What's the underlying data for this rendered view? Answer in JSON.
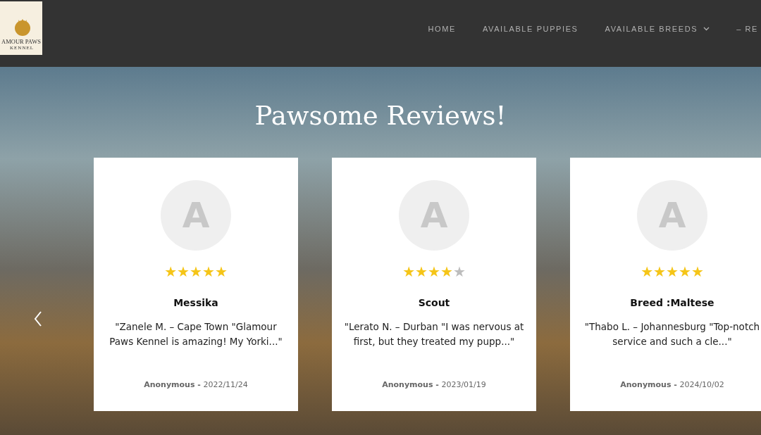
{
  "logo": {
    "name": "AMOUR PAWS",
    "tagline": "KENNEL"
  },
  "nav": [
    {
      "label": "HOME",
      "dropdown": false
    },
    {
      "label": "AVAILABLE PUPPIES",
      "dropdown": false
    },
    {
      "label": "AVAILABLE BREEDS",
      "dropdown": true
    },
    {
      "label": "– RE",
      "dropdown": false
    }
  ],
  "title": "Pawsome Reviews!",
  "reviews": [
    {
      "avatar": "A",
      "stars": 5,
      "name": "Messika",
      "text": "\"Zanele M. – Cape Town \"Glamour Paws Kennel is amazing! My Yorki...\"",
      "author": "Anonymous -",
      "date": "2022/11/24"
    },
    {
      "avatar": "A",
      "stars": 4,
      "name": "Scout",
      "text": "\"Lerato N. – Durban \"I was nervous at first, but they treated my pupp...\"",
      "author": "Anonymous -",
      "date": "2023/01/19"
    },
    {
      "avatar": "A",
      "stars": 5,
      "name": "Breed :Maltese",
      "text": "\"Thabo L. – Johannesburg \"Top-notch service and such a cle...\"",
      "author": "Anonymous -",
      "date": "2024/10/02"
    }
  ]
}
